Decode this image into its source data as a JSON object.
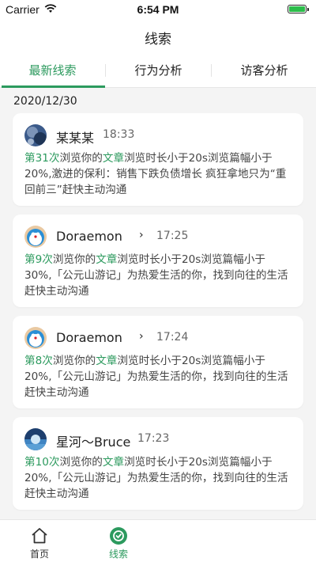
{
  "status_bar": {
    "carrier": "Carrier",
    "time": "6:54 PM"
  },
  "nav": {
    "title": "线索"
  },
  "tabs": [
    {
      "label": "最新线索",
      "active": true
    },
    {
      "label": "行为分析",
      "active": false
    },
    {
      "label": "访客分析",
      "active": false
    }
  ],
  "date": "2020/12/30",
  "cards": [
    {
      "name": "某某某",
      "time": "18:33",
      "count": "第31次",
      "t1": "浏览你的",
      "link": "文章",
      "rest": "浏览时长小于20s浏览篇幅小于20%,激进的保利：销售下跌负债增长 疯狂拿地只为“重回前三”赶快主动沟通"
    },
    {
      "name": "Doraemon",
      "chevron": "›",
      "time": "17:25",
      "count": "第9次",
      "t1": "浏览你的",
      "link": "文章",
      "rest": "浏览时长小于20s浏览篇幅小于30%,「公元山游记」为热爱生活的你，找到向往的生活赶快主动沟通"
    },
    {
      "name": "Doraemon",
      "chevron": "›",
      "time": "17:24",
      "count": "第8次",
      "t1": "浏览你的",
      "link": "文章",
      "rest": "浏览时长小于20s浏览篇幅小于20%,「公元山游记」为热爱生活的你，找到向往的生活赶快主动沟通"
    },
    {
      "name": "星河～Bruce",
      "time": "17:23",
      "count": "第10次",
      "t1": "浏览你的",
      "link": "文章",
      "rest": "浏览时长小于20s浏览篇幅小于20%,「公元山游记」为热爱生活的你，找到向往的生活赶快主动沟通"
    }
  ],
  "tabbar": [
    {
      "label": "首页",
      "icon": "home-icon",
      "active": false
    },
    {
      "label": "线索",
      "icon": "clue-icon",
      "active": true
    }
  ],
  "colors": {
    "accent": "#2c9a5e",
    "background": "#f4f4f4"
  }
}
